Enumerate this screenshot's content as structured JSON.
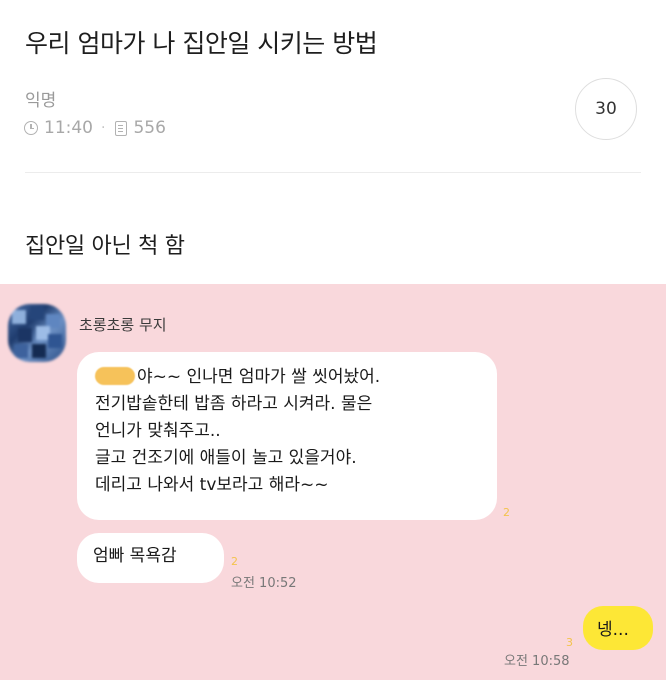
{
  "post": {
    "title": "우리 엄마가 나 집안일 시키는 방법",
    "author": "익명",
    "time": "11:40",
    "views": "556",
    "comment_count": "30",
    "body": "집안일 아닌 척 함"
  },
  "chat": {
    "sender_name": "초롱초롱 무지",
    "message_1": {
      "lines": [
        "야~~ 인나면 엄마가 쌀 씻어놨어.",
        "전기밥솥한테 밥좀 하라고 시켜라. 물은",
        "언니가 맞춰주고..",
        "글고 건조기에 애들이 놀고 있을거야.",
        "데리고 나와서 tv보라고 해라~~"
      ],
      "unread": "2"
    },
    "message_2": {
      "text": "엄빠 목욕감",
      "unread": "2",
      "time": "오전 10:52"
    },
    "message_3": {
      "text": "넹...",
      "unread": "3",
      "time": "오전 10:58"
    }
  },
  "icons": {
    "time": "clock-icon",
    "views": "document-icon"
  },
  "colors": {
    "chat_background": "#f9d8dc",
    "my_bubble": "#fde736",
    "their_bubble": "#ffffff",
    "unread": "#f3c34c"
  }
}
